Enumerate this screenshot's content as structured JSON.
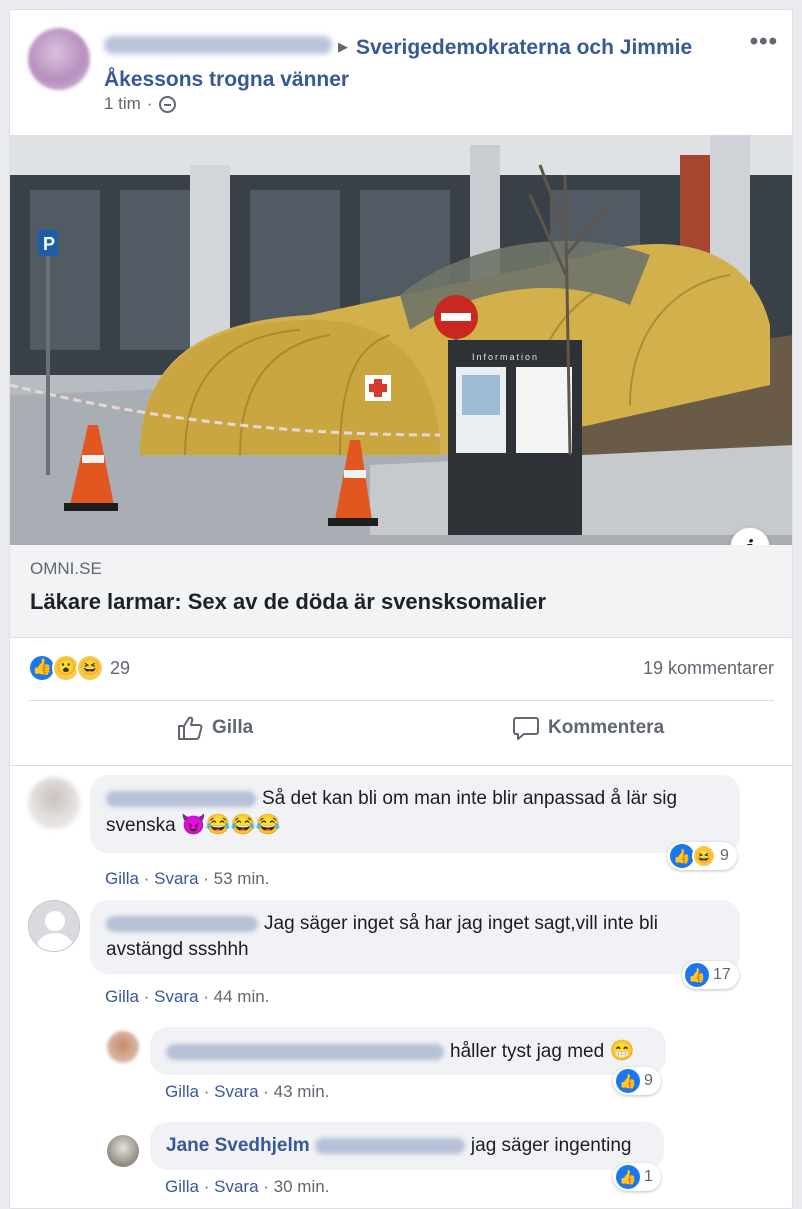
{
  "post": {
    "group_name": "Sverigedemokraterna och Jimmie Åkessons trogna vänner",
    "time": "1 tim",
    "separator": "·",
    "more_label": "•••"
  },
  "link": {
    "domain": "OMNI.SE",
    "title": "Läkare larmar: Sex av de döda är svensksomalier",
    "info_label": "i",
    "sign_text": "Information"
  },
  "reactions": {
    "icons": [
      "like-icon",
      "wow-icon",
      "haha-icon"
    ],
    "count": "29",
    "comments_count": "19 kommentarer"
  },
  "actions": {
    "like_label": "Gilla",
    "comment_label": "Kommentera"
  },
  "comments": [
    {
      "text": "Så det kan bli om man inte blir anpassad å lär sig svenska",
      "emoji": "😈😂😂😂",
      "like": "Gilla",
      "reply": "Svara",
      "time": "53 min.",
      "reaction_count": "9",
      "reaction_icons": [
        "like-icon",
        "haha-icon"
      ]
    },
    {
      "text": "Jag säger inget så har jag inget sagt,vill inte bli avstängd ssshhh",
      "like": "Gilla",
      "reply": "Svara",
      "time": "44 min.",
      "reaction_count": "17",
      "reaction_icons": [
        "like-icon"
      ]
    },
    {
      "text": "håller tyst jag med",
      "emoji": "😁",
      "like": "Gilla",
      "reply": "Svara",
      "time": "43 min.",
      "reaction_count": "9",
      "reaction_icons": [
        "like-icon"
      ]
    },
    {
      "author": "Jane Svedhjelm",
      "text": "jag säger ingenting",
      "like": "Gilla",
      "reply": "Svara",
      "time": "30 min.",
      "reaction_count": "1",
      "reaction_icons": [
        "like-icon"
      ]
    }
  ],
  "colors": {
    "link_blue": "#385898",
    "reaction_blue": "#1877f2",
    "meta_gray": "#606770"
  }
}
